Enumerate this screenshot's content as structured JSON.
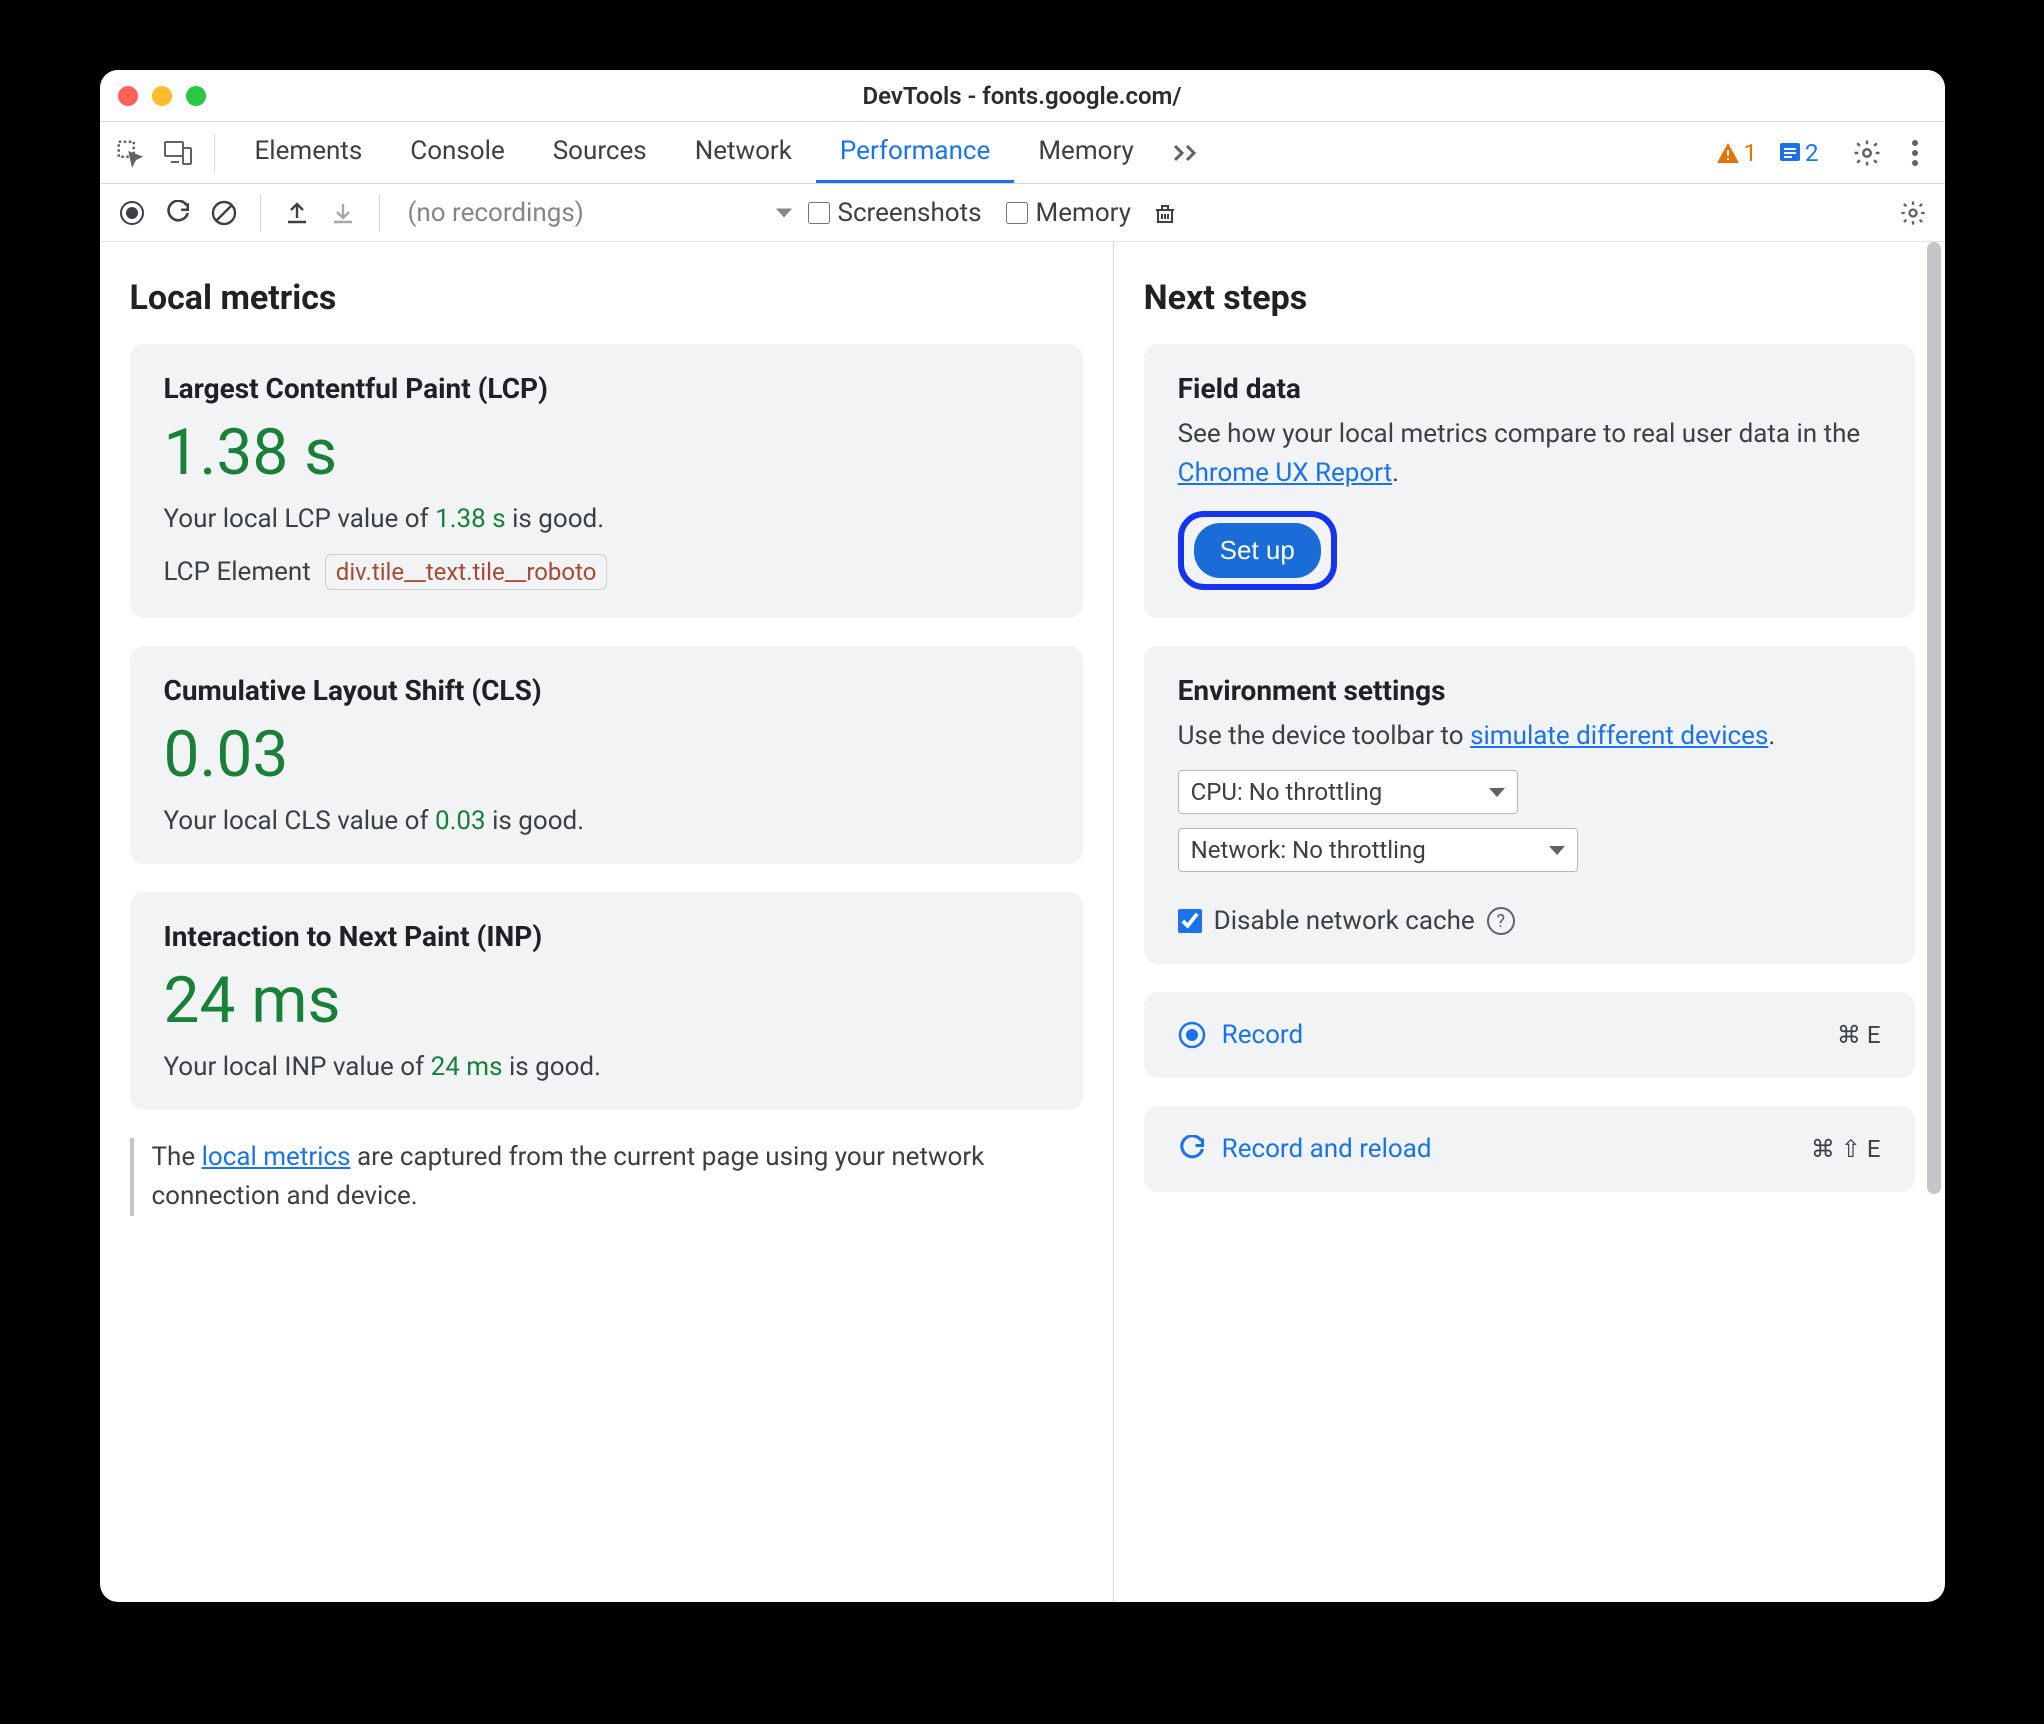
{
  "window": {
    "title": "DevTools - fonts.google.com/"
  },
  "toolbar": {
    "tabs": [
      "Elements",
      "Console",
      "Sources",
      "Network",
      "Performance",
      "Memory"
    ],
    "active_tab": "Performance",
    "warn_count": "1",
    "info_count": "2"
  },
  "subtoolbar": {
    "dropdown": "(no recordings)",
    "screenshots_label": "Screenshots",
    "memory_label": "Memory"
  },
  "local": {
    "heading": "Local metrics",
    "lcp": {
      "name": "Largest Contentful Paint (LCP)",
      "value": "1.38 s",
      "desc_pre": "Your local LCP value of ",
      "desc_val": "1.38 s",
      "desc_post": " is good.",
      "elem_label": "LCP Element",
      "elem_sel": "div.tile__text.tile__roboto"
    },
    "cls": {
      "name": "Cumulative Layout Shift (CLS)",
      "value": "0.03",
      "desc_pre": "Your local CLS value of ",
      "desc_val": "0.03",
      "desc_post": " is good."
    },
    "inp": {
      "name": "Interaction to Next Paint (INP)",
      "value": "24 ms",
      "desc_pre": "Your local INP value of ",
      "desc_val": "24 ms",
      "desc_post": " is good."
    },
    "note_pre": "The ",
    "note_link": "local metrics",
    "note_post": " are captured from the current page using your network connection and device."
  },
  "next": {
    "heading": "Next steps",
    "field": {
      "title": "Field data",
      "text_pre": "See how your local metrics compare to real user data in the ",
      "link": "Chrome UX Report",
      "text_post": ".",
      "setup": "Set up"
    },
    "env": {
      "title": "Environment settings",
      "text_pre": "Use the device toolbar to ",
      "link": "simulate different devices",
      "text_post": ".",
      "cpu": "CPU: No throttling",
      "network": "Network: No throttling",
      "disable_cache": "Disable network cache"
    },
    "record": {
      "label": "Record",
      "shortcut": "⌘ E"
    },
    "record_reload": {
      "label": "Record and reload",
      "shortcut": "⌘ ⇧ E"
    }
  }
}
